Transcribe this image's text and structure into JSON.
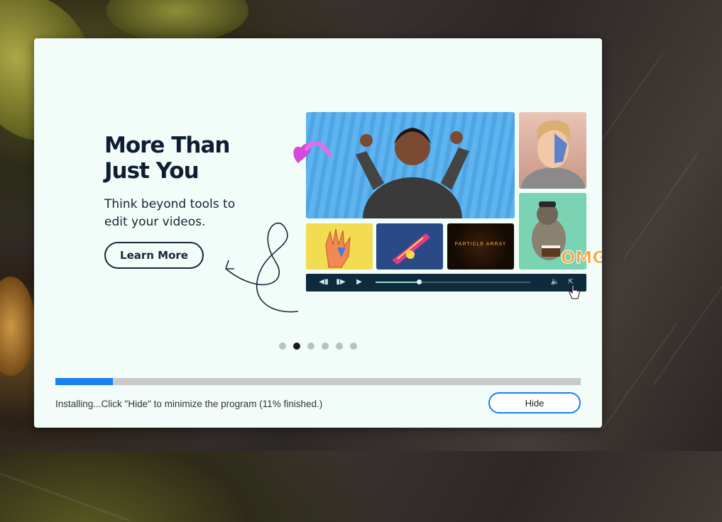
{
  "slide": {
    "title_line1": "More Than",
    "title_line2": "Just You",
    "subtitle_line1": "Think beyond tools to",
    "subtitle_line2": "edit your videos.",
    "learn_more_label": "Learn More",
    "tile_label": "PARTICLE ARRAY",
    "sticker_text": "OMG"
  },
  "carousel": {
    "dot_count": 6,
    "active_index": 1
  },
  "player": {
    "progress_fraction": 0.28,
    "icons": [
      "rewind-icon",
      "step-forward-icon",
      "play-icon",
      "volume-icon",
      "fullscreen-icon"
    ]
  },
  "install": {
    "progress_percent": 11,
    "status_text": "Installing...Click \"Hide\" to minimize the program (11% finished.)",
    "hide_label": "Hide"
  },
  "colors": {
    "accent": "#1a7ff0",
    "dialog_bg": "#f2fcf9",
    "title": "#0e1d33",
    "player_bar": "#0e2a3c"
  }
}
